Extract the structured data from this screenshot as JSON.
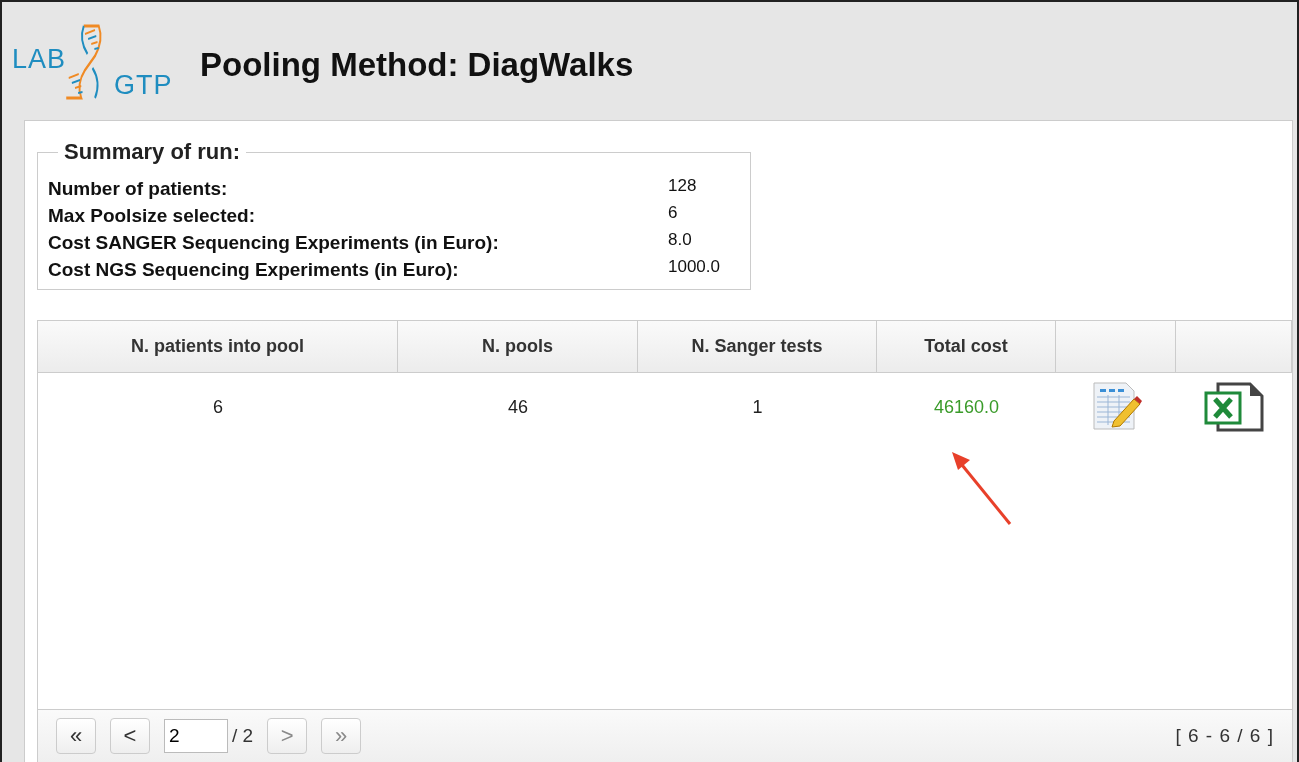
{
  "header": {
    "logo": {
      "top": "LAB",
      "bottom": "GTP"
    },
    "title": "Pooling Method: DiagWalks"
  },
  "summary": {
    "legend": "Summary of run:",
    "rows": [
      {
        "label": "Number of patients:",
        "value": "128"
      },
      {
        "label": "Max Poolsize selected:",
        "value": "6"
      },
      {
        "label": "Cost SANGER Sequencing Experiments (in Euro):",
        "value": "8.0"
      },
      {
        "label": "Cost NGS Sequencing Experiments (in Euro):",
        "value": "1000.0"
      }
    ]
  },
  "table": {
    "columns": [
      "N. patients into pool",
      "N. pools",
      "N. Sanger tests",
      "Total cost",
      "",
      ""
    ],
    "rows": [
      {
        "patients_into_pool": "6",
        "pools": "46",
        "sanger_tests": "1",
        "total_cost": "46160.0"
      }
    ]
  },
  "pager": {
    "buttons": [
      {
        "glyph": "«",
        "disabled": false
      },
      {
        "glyph": "<",
        "disabled": false
      }
    ],
    "page": "2",
    "of": "/ 2",
    "buttons_after": [
      {
        "glyph": ">",
        "disabled": true
      },
      {
        "glyph": "»",
        "disabled": true
      }
    ],
    "range": "[ 6 - 6 / 6 ]"
  }
}
